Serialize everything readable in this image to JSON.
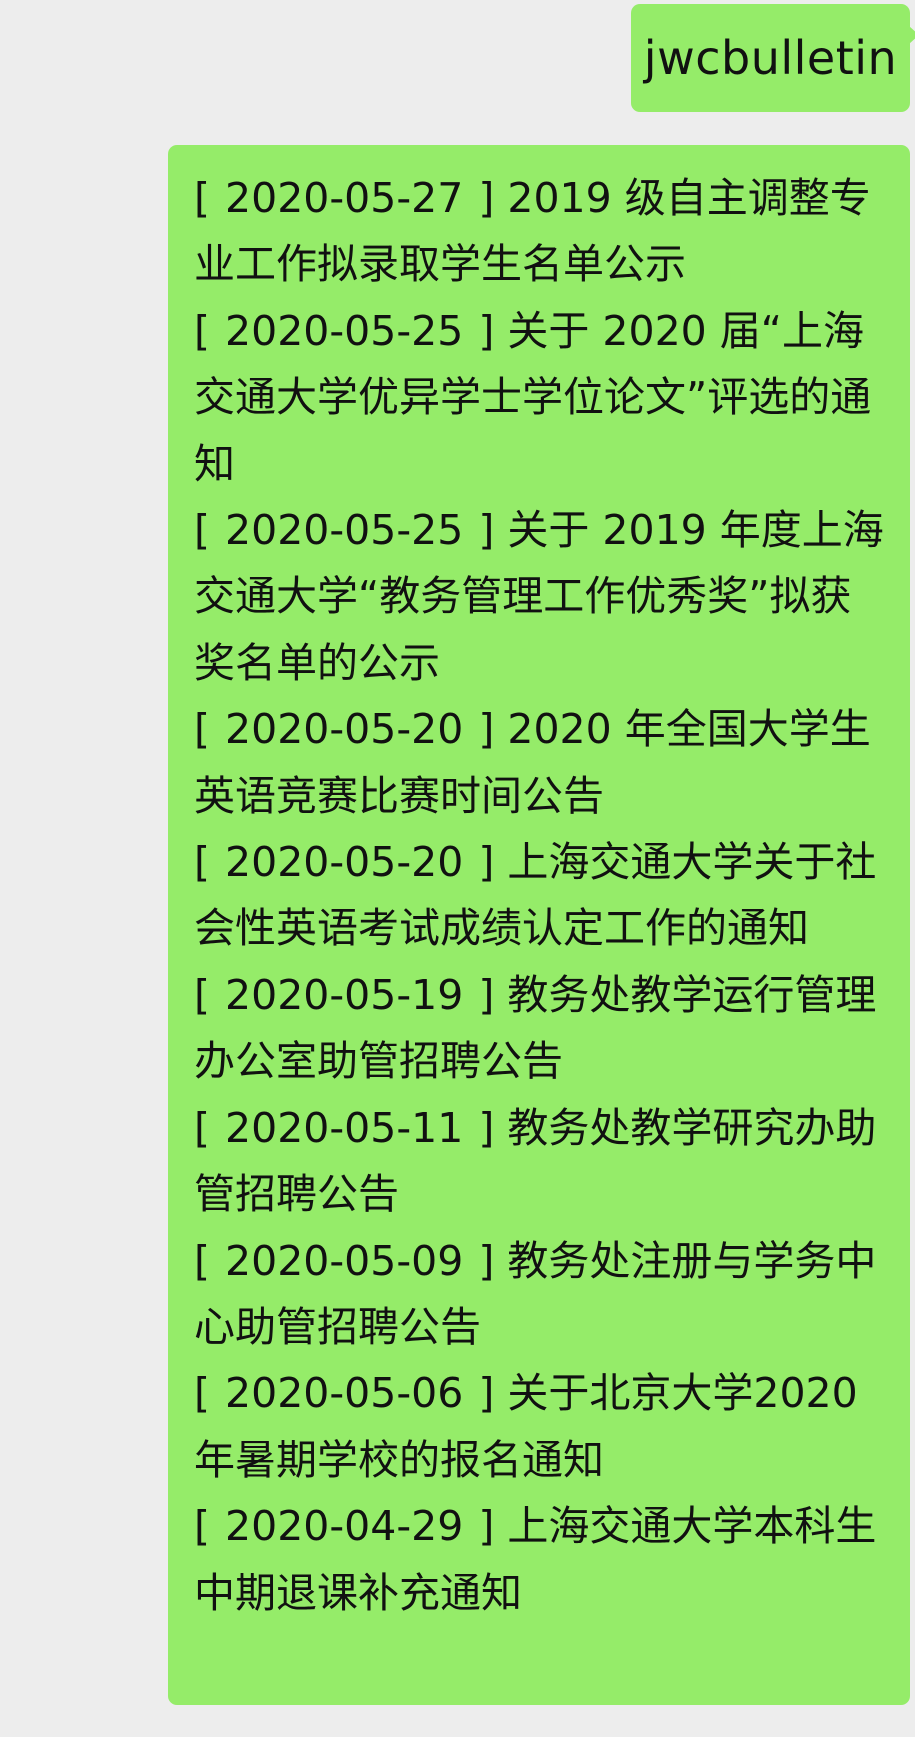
{
  "messages": {
    "command": {
      "text": "jwcbulletin"
    },
    "reply": {
      "items": [
        {
          "date": "[ 2020-05-27 ]",
          "title": "2019 级自主调整专业工作拟录取学生名单公示"
        },
        {
          "date": "[ 2020-05-25 ]",
          "title": "关于 2020 届“上海交通大学优异学士学位论文”评选的通知"
        },
        {
          "date": "[ 2020-05-25 ]",
          "title": "关于 2019 年度上海交通大学“教务管理工作优秀奖”拟获奖名单的公示"
        },
        {
          "date": "[ 2020-05-20 ]",
          "title": "2020 年全国大学生英语竞赛比赛时间公告"
        },
        {
          "date": "[ 2020-05-20 ]",
          "title": "上海交通大学关于社会性英语考试成绩认定工作的通知"
        },
        {
          "date": "[ 2020-05-19 ]",
          "title": "教务处教学运行管理办公室助管招聘公告"
        },
        {
          "date": "[ 2020-05-11 ]",
          "title": "教务处教学研究办助管招聘公告"
        },
        {
          "date": "[ 2020-05-09 ]",
          "title": "教务处注册与学务中心助管招聘公告"
        },
        {
          "date": "[ 2020-05-06 ]",
          "title": "关于北京大学2020 年暑期学校的报名通知"
        },
        {
          "date": "[ 2020-04-29 ]",
          "title": "上海交通大学本科生中期退课补充通知"
        }
      ]
    }
  },
  "colors": {
    "background": "#ededed",
    "bubble_green": "#95ec69"
  }
}
